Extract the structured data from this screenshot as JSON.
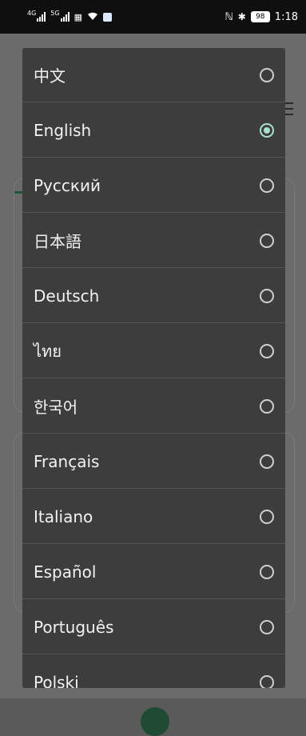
{
  "status_bar": {
    "network_labels": [
      "4G",
      "5G"
    ],
    "time": "1:18",
    "battery": "98",
    "nfc_symbol": "ℕ",
    "bluetooth_symbol": "✱"
  },
  "language_dialog": {
    "selected": "English",
    "accent_color": "#a8e0cb",
    "options": [
      {
        "label": "中文",
        "selected": false
      },
      {
        "label": "English",
        "selected": true
      },
      {
        "label": "Русский",
        "selected": false
      },
      {
        "label": "日本語",
        "selected": false
      },
      {
        "label": "Deutsch",
        "selected": false
      },
      {
        "label": "ไทย",
        "selected": false
      },
      {
        "label": "한국어",
        "selected": false
      },
      {
        "label": "Français",
        "selected": false
      },
      {
        "label": "Italiano",
        "selected": false
      },
      {
        "label": "Español",
        "selected": false
      },
      {
        "label": "Português",
        "selected": false
      },
      {
        "label": "Polski",
        "selected": false
      }
    ]
  }
}
